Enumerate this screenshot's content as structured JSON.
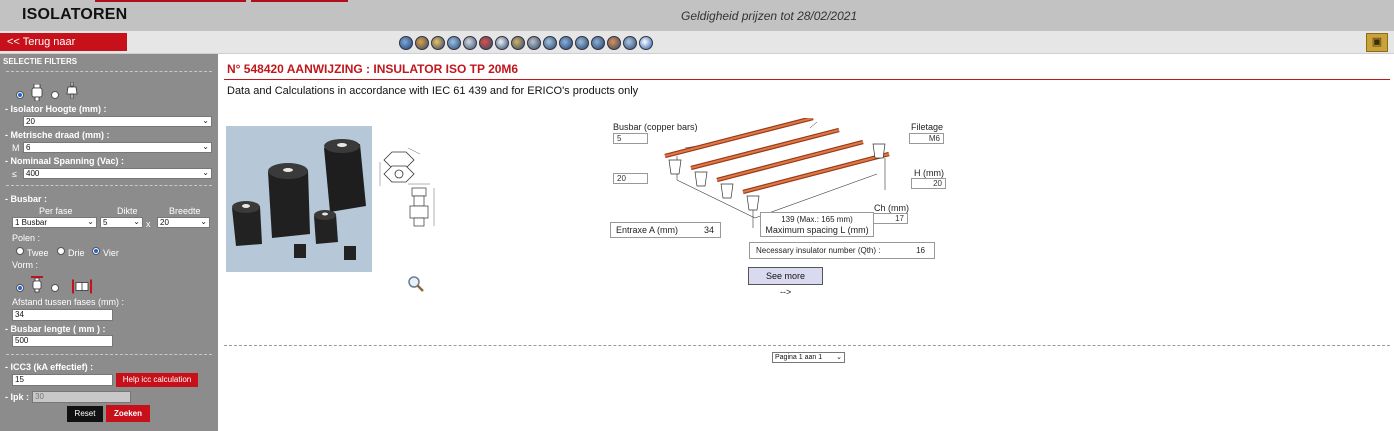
{
  "header": {
    "title": "ISOLATOREN",
    "validity": "Geldigheid prijzen tot 28/02/2021"
  },
  "nav": {
    "back_label": "<< Terug naar panorama",
    "category_icons": [
      "busbar-icon",
      "insulator-icon",
      "clamp-icon",
      "connector-icon",
      "lug-icon",
      "tool-icon",
      "terminal-icon",
      "cable-icon",
      "grounding-icon",
      "rod-icon",
      "spark-icon",
      "holder-icon",
      "box-icon",
      "switch-icon",
      "fuse-icon",
      "info-icon"
    ],
    "folder_icon": "folder-icon"
  },
  "filters": {
    "section_title": "SELECTIE FILTERS",
    "insulator_type_selected": 0,
    "height_label": "- Isolator Hoogte (mm) :",
    "height_value": "20",
    "thread_label": "- Metrische draad (mm) :",
    "thread_prefix": "M",
    "thread_value": "6",
    "voltage_label": "- Nominaal Spanning (Vac) :",
    "voltage_prefix": "≤",
    "voltage_value": "400",
    "busbar_label": "- Busbar :",
    "per_phase_label": "Per fase",
    "thickness_label": "Dikte",
    "width_label": "Breedte",
    "per_phase_value": "1 Busbar",
    "thickness_value": "5",
    "times": "x",
    "width_value": "20",
    "poles_label": "Polen :",
    "poles_options": [
      "Twee",
      "Drie",
      "Vier"
    ],
    "poles_selected": 2,
    "shape_label": "Vorm :",
    "shape_selected": 0,
    "phase_distance_label": "Afstand tussen fases (mm) :",
    "phase_distance_value": "34",
    "busbar_length_label": "- Busbar lengte ( mm ) :",
    "busbar_length_value": "500",
    "icc3_label": "- ICC3 (kA effectief) :",
    "icc3_value": "15",
    "help_icc_label": "Help icc calculation",
    "ipk_label": "- Ipk :",
    "ipk_value": "30",
    "reset_label": "Reset",
    "search_label": "Zoeken"
  },
  "product": {
    "title": "N° 548420  AANWIJZING : INSULATOR ISO TP 20M6",
    "subtitle": "Data and Calculations in accordance with IEC 61 439 and for ERICO's products only"
  },
  "diagram": {
    "busbar_label": "Busbar (copper bars)",
    "busbar_thickness": "5",
    "busbar_width": "20",
    "thread_label": "Filetage",
    "thread_value": "M6",
    "height_label": "H (mm)",
    "height_value": "20",
    "ch_label": "Ch (mm)",
    "ch_value": "17",
    "entraxe_label": "Entraxe A (mm)",
    "entraxe_value": "34",
    "max_spacing_value": "139 (Max.: 165 mm)",
    "max_spacing_label": "Maximum spacing L (mm)",
    "necessary_label": "Necessary insulator number (Qth) :",
    "necessary_value": "16",
    "see_more_label": "See more",
    "arrow_label": "-->"
  },
  "pagination": {
    "value": "Pagina 1 aan 1"
  },
  "colors": {
    "brand_red": "#c8101b",
    "sidebar_gray": "#8c8c8c",
    "header_gray": "#c2c2c2"
  }
}
